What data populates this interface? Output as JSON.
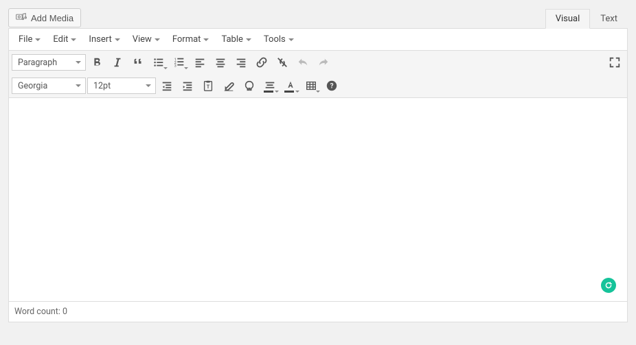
{
  "top": {
    "add_media_label": "Add Media",
    "tabs": {
      "visual": "Visual",
      "text": "Text"
    }
  },
  "menubar": {
    "file": "File",
    "edit": "Edit",
    "insert": "Insert",
    "view": "View",
    "format": "Format",
    "table": "Table",
    "tools": "Tools"
  },
  "toolbar1": {
    "format_select": "Paragraph"
  },
  "toolbar2": {
    "font_family": "Georgia",
    "font_size": "12pt"
  },
  "status": {
    "word_count_label": "Word count: 0"
  },
  "colors": {
    "accent": "#15c39a"
  }
}
